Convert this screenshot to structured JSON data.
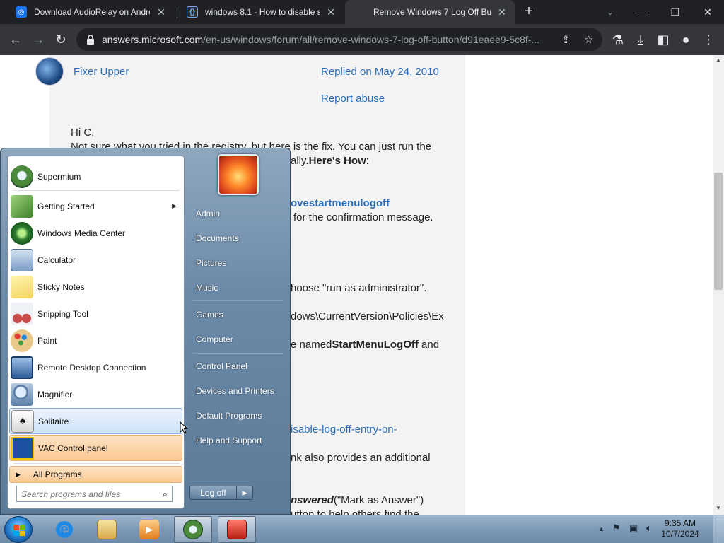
{
  "browser": {
    "tabs": [
      {
        "title": "Download AudioRelay on Andro",
        "favicon_color": "#1a73e8"
      },
      {
        "title": "windows 8.1 - How to disable sh",
        "favicon_color": "#2b2d31"
      },
      {
        "title": "Remove Windows 7 Log Off Butt",
        "favicon_color": "#f25022"
      }
    ],
    "active_tab": 2,
    "url_host": "answers.microsoft.com",
    "url_path": "/en-us/windows/forum/all/remove-windows-7-log-off-button/d91eaee9-5c8f-..."
  },
  "post": {
    "author": "Fixer Upper",
    "replied": "Replied on May 24, 2010",
    "report": "Report abuse",
    "greeting": "Hi C,",
    "line1": "Not sure what you tried in the registry, but here is the fix. You can just run the",
    "line2_tail": "ally.",
    "heres_how": "Here's How",
    "line2_colon": ":",
    "link_tail": "ovestartmenulogoff",
    "confirm_tail": "for the confirmation message.",
    "runas_tail": "hoose \"run as administrator\".",
    "path_tail": "dows\\CurrentVersion\\Policies\\Ex",
    "named_prefix": "e named",
    "named_key": "StartMenuLogOff",
    "named_suffix": " and",
    "link2_tail": "isable-log-off-entry-on-",
    "additional_tail": "nk also provides an additional",
    "answered_bold": "nswered",
    "answered_rest": "(\"Mark as Answer\")",
    "button_tail": "utton to help others find the"
  },
  "startmenu": {
    "programs": [
      {
        "label": "Supermium",
        "color": "#4a8a3a",
        "submenu": false
      },
      {
        "label": "Getting Started",
        "color": "#6aa84f",
        "submenu": true
      },
      {
        "label": "Windows Media Center",
        "color": "#2e7d32",
        "submenu": false
      },
      {
        "label": "Calculator",
        "color": "#7a9cc6",
        "submenu": false
      },
      {
        "label": "Sticky Notes",
        "color": "#f4d35e",
        "submenu": false
      },
      {
        "label": "Snipping Tool",
        "color": "#c94f4f",
        "submenu": false
      },
      {
        "label": "Paint",
        "color": "#d9a441",
        "submenu": false
      },
      {
        "label": "Remote Desktop Connection",
        "color": "#3a6ea5",
        "submenu": false
      },
      {
        "label": "Magnifier",
        "color": "#5b7fa8",
        "submenu": false
      },
      {
        "label": "Solitaire",
        "color": "#e0e0e0",
        "submenu": false
      },
      {
        "label": "VAC Control panel",
        "color": "#1f4fa0",
        "submenu": false
      }
    ],
    "all_programs": "All Programs",
    "search_placeholder": "Search programs and files",
    "right_items": [
      "Admin",
      "Documents",
      "Pictures",
      "Music",
      "Games",
      "Computer",
      "Control Panel",
      "Devices and Printers",
      "Default Programs",
      "Help and Support"
    ],
    "logoff": "Log off"
  },
  "taskbar": {
    "time": "9:35 AM",
    "date": "10/7/2024"
  }
}
